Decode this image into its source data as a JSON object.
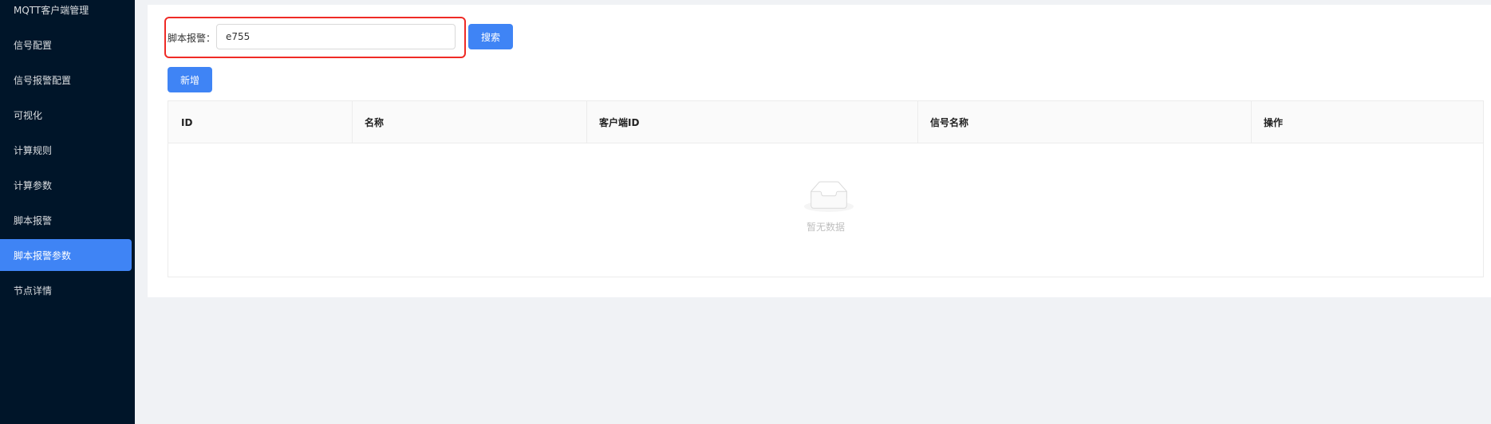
{
  "sidebar": {
    "items": [
      {
        "label": "MQTT客户端管理"
      },
      {
        "label": "信号配置"
      },
      {
        "label": "信号报警配置"
      },
      {
        "label": "可视化"
      },
      {
        "label": "计算规则"
      },
      {
        "label": "计算参数"
      },
      {
        "label": "脚本报警"
      },
      {
        "label": "脚本报警参数",
        "active": true
      },
      {
        "label": "节点详情"
      }
    ]
  },
  "search": {
    "label": "脚本报警：",
    "value": "e755",
    "button": "搜索"
  },
  "toolbar": {
    "add_label": "新增"
  },
  "table": {
    "columns": [
      "ID",
      "名称",
      "客户端ID",
      "信号名称",
      "操作"
    ],
    "rows": [],
    "empty_text": "暂无数据"
  },
  "colors": {
    "sidebar_bg": "#001529",
    "accent": "#3f84f5",
    "highlight": "#ef2b26"
  }
}
